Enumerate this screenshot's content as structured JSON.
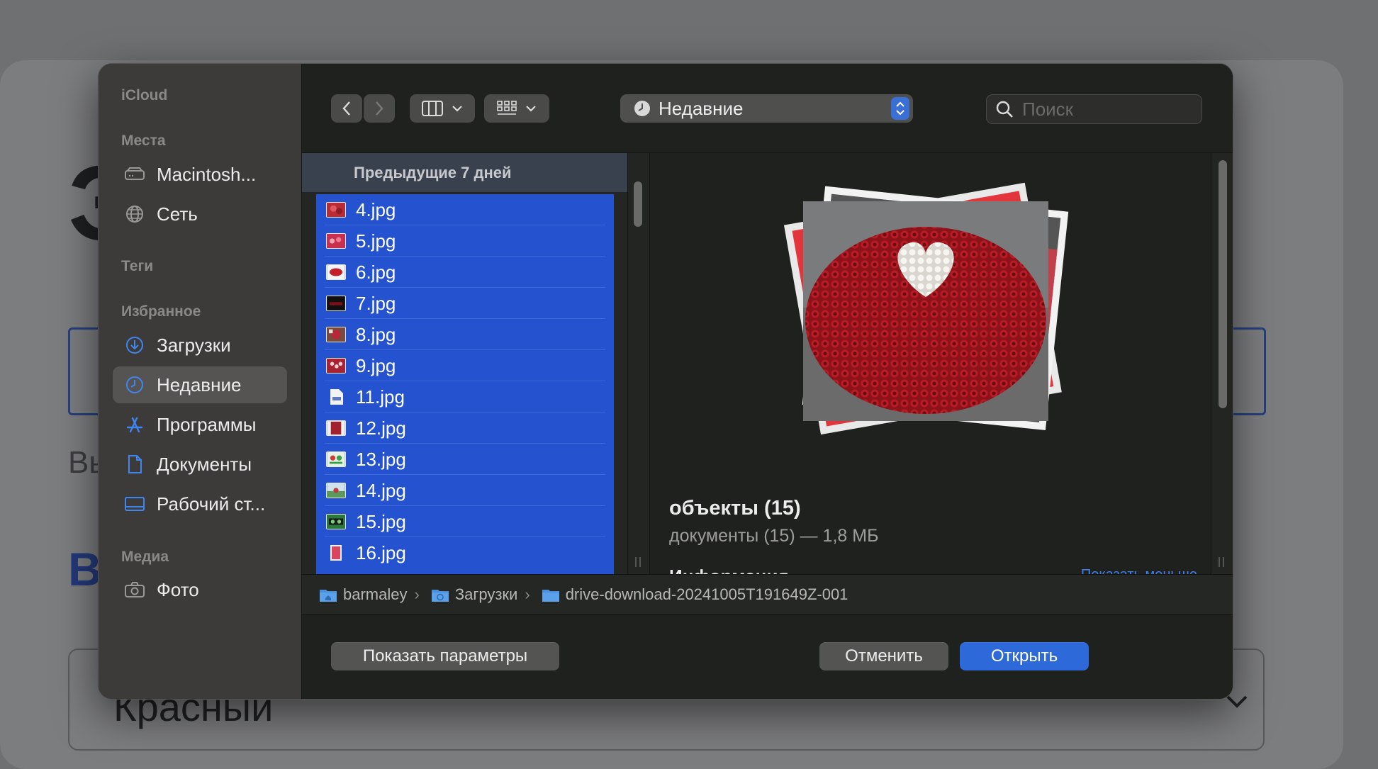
{
  "background": {
    "heading_fragment": "Э",
    "subtitle_fragment": "Вы",
    "section_fragment": "В",
    "select_value": "Красный"
  },
  "sidebar": {
    "icloud_label": "iCloud",
    "places_label": "Места",
    "places": [
      {
        "label": "Macintosh...",
        "icon": "hard-drive-icon"
      },
      {
        "label": "Сеть",
        "icon": "network-globe-icon"
      }
    ],
    "tags_label": "Теги",
    "favorites_label": "Избранное",
    "favorites": [
      {
        "label": "Загрузки",
        "icon": "download-icon"
      },
      {
        "label": "Недавние",
        "icon": "clock-icon",
        "active": true
      },
      {
        "label": "Программы",
        "icon": "apps-icon"
      },
      {
        "label": "Документы",
        "icon": "document-icon"
      },
      {
        "label": "Рабочий ст...",
        "icon": "desktop-icon"
      }
    ],
    "media_label": "Медиа",
    "media": [
      {
        "label": "Фото",
        "icon": "camera-icon"
      }
    ]
  },
  "toolbar": {
    "location_label": "Недавние",
    "search_placeholder": "Поиск"
  },
  "file_list": {
    "group_header": "Предыдущие 7 дней",
    "files": [
      "4.jpg",
      "5.jpg",
      "6.jpg",
      "7.jpg",
      "8.jpg",
      "9.jpg",
      "11.jpg",
      "12.jpg",
      "13.jpg",
      "14.jpg",
      "15.jpg",
      "16.jpg"
    ]
  },
  "preview": {
    "title": "объекты (15)",
    "subtitle": "документы (15) — 1,8 МБ",
    "info_heading": "Информация",
    "show_less": "Показать меньше"
  },
  "path": [
    {
      "label": "barmaley",
      "icon": "home-folder-icon"
    },
    {
      "label": "Загрузки",
      "icon": "downloads-folder-icon"
    },
    {
      "label": "drive-download-20241005T191649Z-001",
      "icon": "folder-icon"
    }
  ],
  "buttons": {
    "options": "Показать параметры",
    "cancel": "Отменить",
    "open": "Открыть"
  },
  "colors": {
    "selection": "#2553cf",
    "accent": "#2e69da",
    "dialog_bg": "#1f211f",
    "sidebar_bg": "#3c3b3a"
  }
}
